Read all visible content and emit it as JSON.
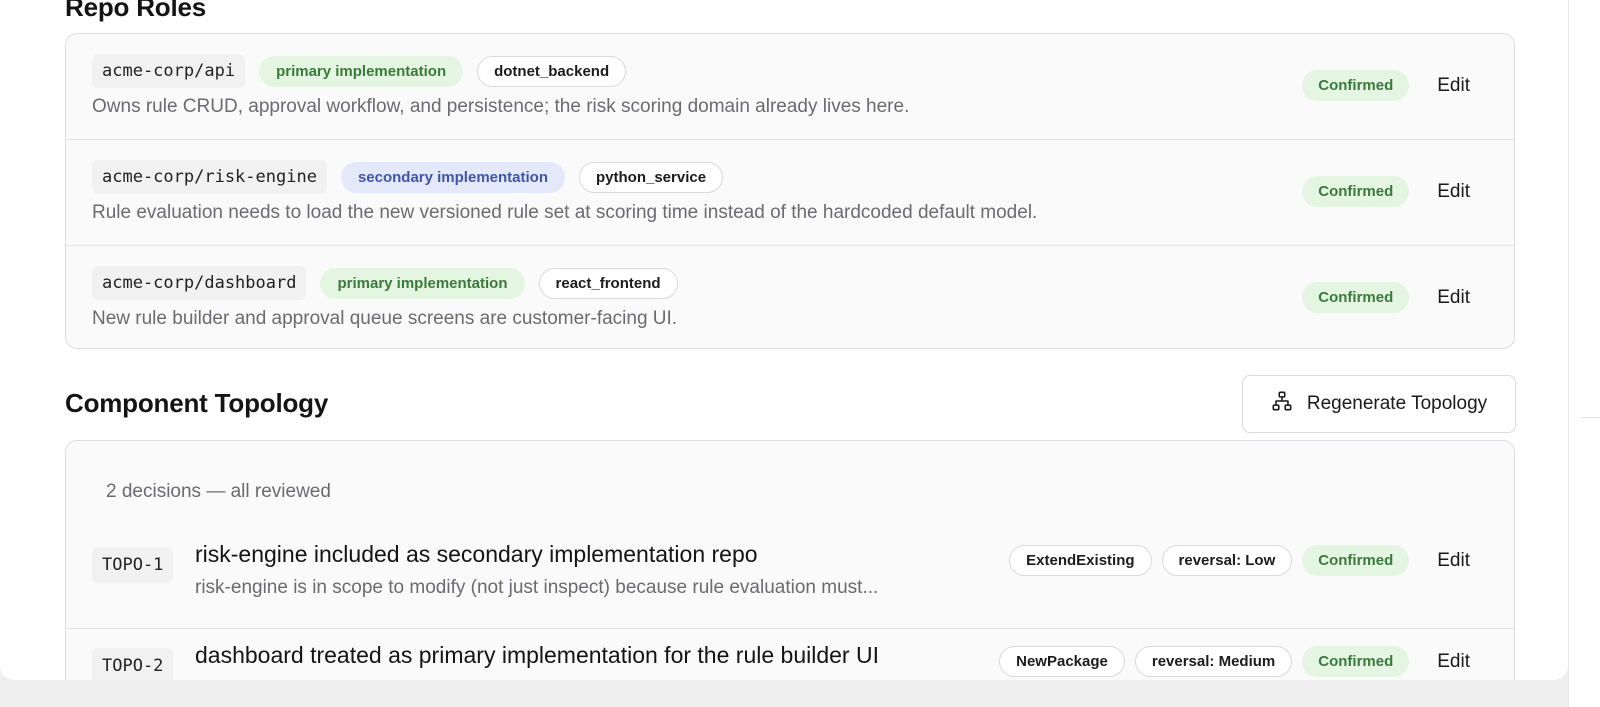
{
  "repo_roles": {
    "title": "Repo Roles",
    "rows": [
      {
        "repo": "acme-corp/api",
        "role": "primary implementation",
        "kind": "dotnet_backend",
        "description": "Owns rule CRUD, approval workflow, and persistence; the risk scoring domain already lives here.",
        "status": "Confirmed",
        "action": "Edit"
      },
      {
        "repo": "acme-corp/risk-engine",
        "role": "secondary implementation",
        "kind": "python_service",
        "description": "Rule evaluation needs to load the new versioned rule set at scoring time instead of the hardcoded default model.",
        "status": "Confirmed",
        "action": "Edit"
      },
      {
        "repo": "acme-corp/dashboard",
        "role": "primary implementation",
        "kind": "react_frontend",
        "description": "New rule builder and approval queue screens are customer-facing UI.",
        "status": "Confirmed",
        "action": "Edit"
      }
    ]
  },
  "topology": {
    "title": "Component Topology",
    "regenerate_label": "Regenerate Topology",
    "regenerate_icon": "sitemap-icon",
    "summary": "2 decisions — all reviewed",
    "decisions": [
      {
        "id": "TOPO-1",
        "title": "risk-engine included as secondary implementation repo",
        "description": "risk-engine is in scope to modify (not just inspect) because rule evaluation must...",
        "type": "ExtendExisting",
        "reversal": "reversal: Low",
        "status": "Confirmed",
        "action": "Edit"
      },
      {
        "id": "TOPO-2",
        "title": "dashboard treated as primary implementation for the rule builder UI",
        "type": "NewPackage",
        "reversal": "reversal: Medium",
        "status": "Confirmed",
        "action": "Edit"
      }
    ]
  },
  "colors": {
    "green_pill_bg": "#e4f6e2",
    "green_pill_text": "#3b7a3b",
    "blue_pill_bg": "#e3e9fb",
    "blue_pill_text": "#3f56a8"
  }
}
